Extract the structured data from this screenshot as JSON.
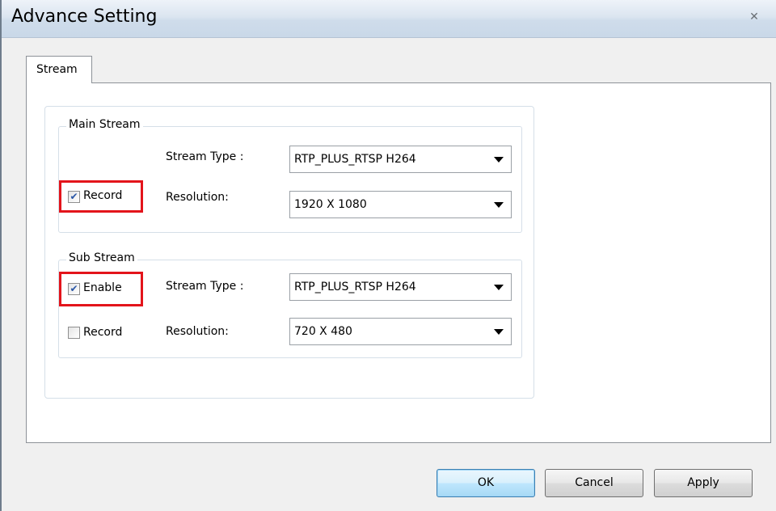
{
  "window": {
    "title": "Advance Setting",
    "close_icon": "close-icon"
  },
  "tabs": [
    {
      "label": "Stream",
      "selected": true
    }
  ],
  "main_stream": {
    "legend": "Main Stream",
    "stream_type_label": "Stream Type :",
    "stream_type_value": "RTP_PLUS_RTSP H264",
    "resolution_label": "Resolution:",
    "resolution_value": "1920 X 1080",
    "record": {
      "label": "Record",
      "checked": true
    }
  },
  "sub_stream": {
    "legend": "Sub Stream",
    "enable": {
      "label": "Enable",
      "checked": true
    },
    "record": {
      "label": "Record",
      "checked": false
    },
    "stream_type_label": "Stream Type :",
    "stream_type_value": "RTP_PLUS_RTSP H264",
    "resolution_label": "Resolution:",
    "resolution_value": "720 X 480"
  },
  "buttons": {
    "ok": "OK",
    "cancel": "Cancel",
    "apply": "Apply"
  },
  "colors": {
    "highlight": "#e3141b",
    "check_mark": "#2a56a6"
  }
}
